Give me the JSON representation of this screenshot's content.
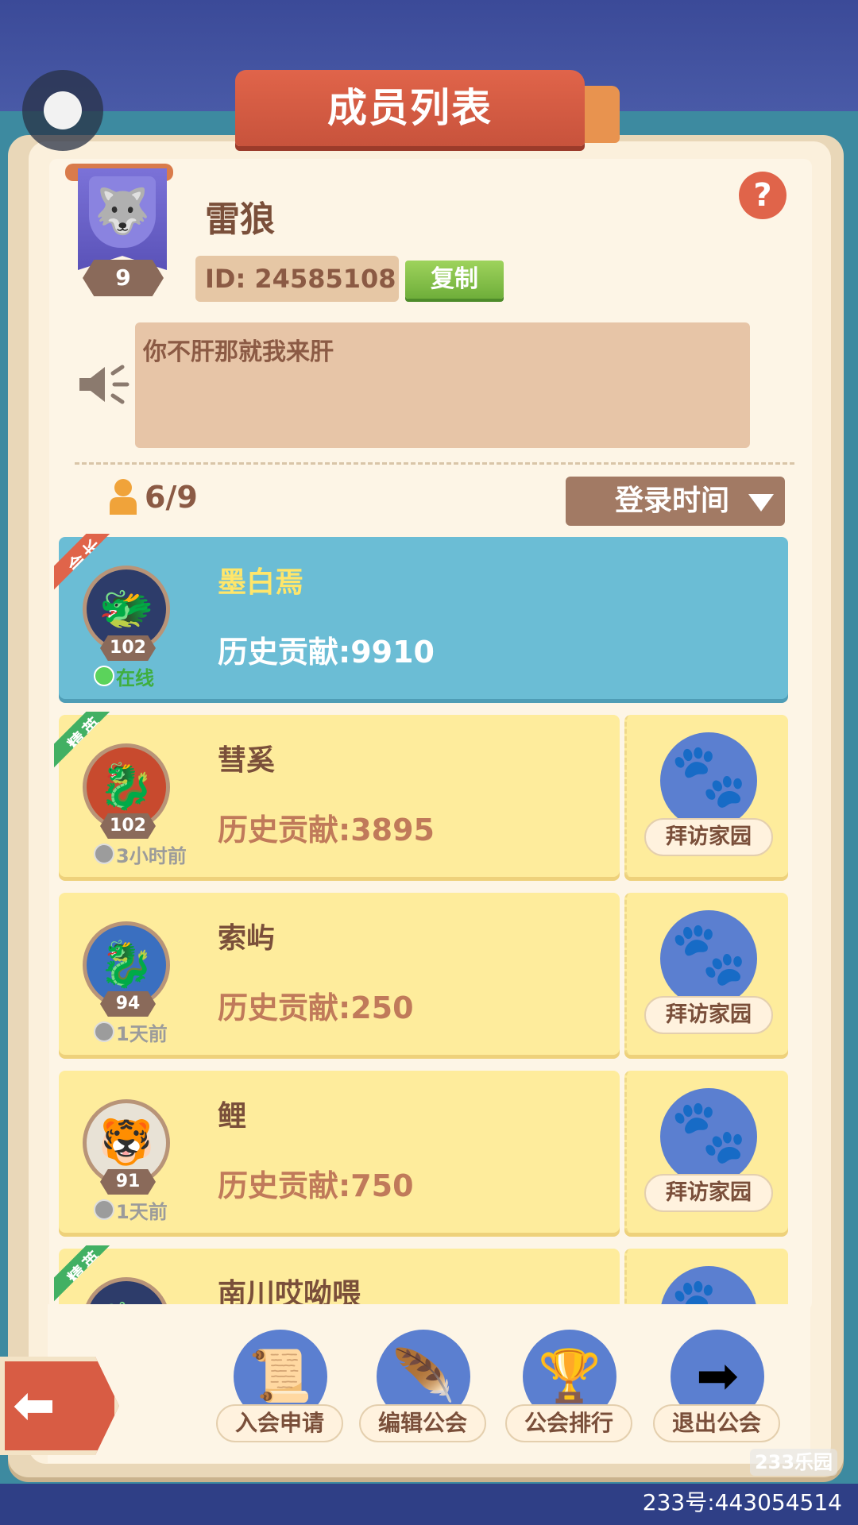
{
  "title": "成员列表",
  "guild": {
    "name": "雷狼",
    "level": "9",
    "id_text": "ID: 24585108",
    "copy_label": "复制",
    "notice": "你不肝那就我来肝",
    "emblem_icon": "wolf-icon"
  },
  "members_count": "6/9",
  "sort_label": "登录时间",
  "members": [
    {
      "name": "墨白焉",
      "level": "102",
      "status": "在线",
      "contribution": "历史贡献:9910",
      "role": "会长",
      "avatar_icon": "dragon-icon"
    },
    {
      "name": "彗奚",
      "level": "102",
      "status": "3小时前",
      "contribution": "历史贡献:3895",
      "role": "精英",
      "avatar_icon": "dragon-icon",
      "action": "拜访家园"
    },
    {
      "name": "索屿",
      "level": "94",
      "status": "1天前",
      "contribution": "历史贡献:250",
      "role": "",
      "avatar_icon": "dragon-icon",
      "action": "拜访家园"
    },
    {
      "name": "鲤",
      "level": "91",
      "status": "1天前",
      "contribution": "历史贡献:750",
      "role": "",
      "avatar_icon": "tiger-icon",
      "action": "拜访家园"
    },
    {
      "name": "南川哎呦喂",
      "level": "",
      "status": "",
      "contribution": "",
      "role": "精英",
      "avatar_icon": "dragon-icon",
      "action": ""
    }
  ],
  "toolbar": [
    {
      "label": "入会申请",
      "icon": "scroll-icon"
    },
    {
      "label": "编辑公会",
      "icon": "quill-icon"
    },
    {
      "label": "公会排行",
      "icon": "podium-icon"
    },
    {
      "label": "退出公会",
      "icon": "exit-icon"
    }
  ],
  "watermark": "233乐园",
  "account_id": "233号:443054514",
  "colors": {
    "leader_row": "#6bbdd5",
    "member_row": "#feec9c",
    "title_banner": "#d85c44"
  }
}
